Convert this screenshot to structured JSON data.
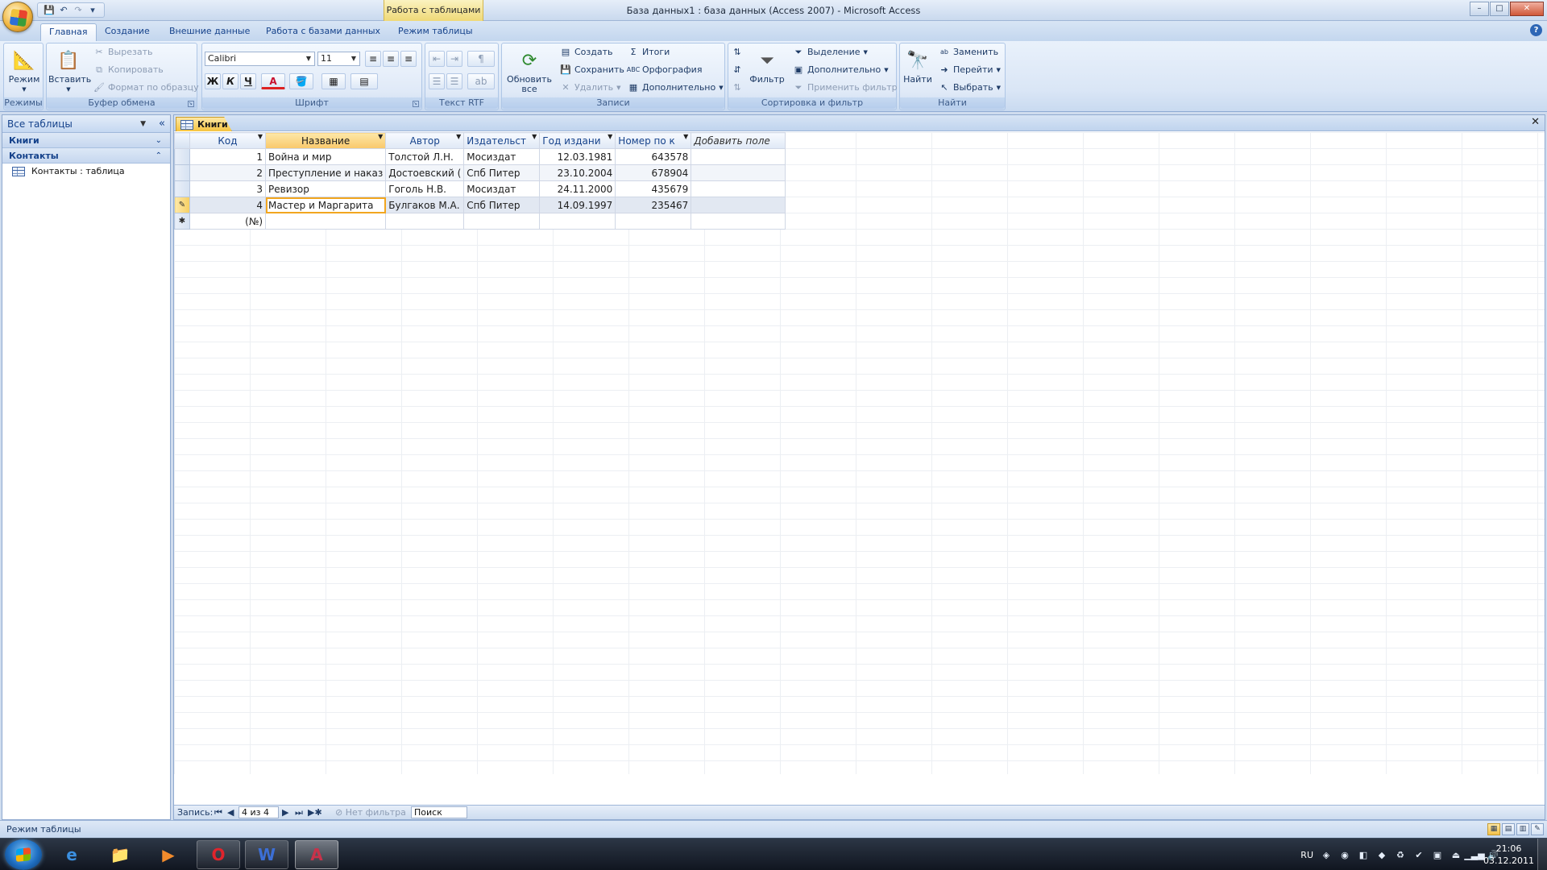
{
  "window": {
    "title": "База данных1 : база данных (Access 2007) - Microsoft Access",
    "context_tab": "Работа с таблицами",
    "controls": {
      "minimize": "–",
      "maximize": "□",
      "close": "✕"
    }
  },
  "quick_access": {
    "save": "💾",
    "undo": "↶",
    "redo": "↷",
    "customize": "▾"
  },
  "ribbon_tabs": [
    "Главная",
    "Создание",
    "Внешние данные",
    "Работа с базами данных",
    "Режим таблицы"
  ],
  "ribbon": {
    "views": {
      "group": "Режимы",
      "view_button": "Режим"
    },
    "clipboard": {
      "group": "Буфер обмена",
      "paste": "Вставить",
      "cut": "Вырезать",
      "copy": "Копировать",
      "format_painter": "Формат по образцу"
    },
    "font": {
      "group": "Шрифт",
      "font_name": "Calibri",
      "font_size": "11",
      "bold": "Ж",
      "italic": "К",
      "underline": "Ч",
      "font_color": "A"
    },
    "rich_text": {
      "group": "Текст RTF"
    },
    "records": {
      "group": "Записи",
      "refresh": "Обновить все",
      "new": "Создать",
      "save": "Сохранить",
      "delete": "Удалить",
      "totals": "Итоги",
      "spelling": "Орфография",
      "more": "Дополнительно"
    },
    "sort_filter": {
      "group": "Сортировка и фильтр",
      "filter": "Фильтр",
      "selection": "Выделение",
      "advanced": "Дополнительно",
      "toggle_filter": "Применить фильтр"
    },
    "find": {
      "group": "Найти",
      "find": "Найти",
      "replace": "Заменить",
      "goto": "Перейти",
      "select": "Выбрать"
    }
  },
  "nav_pane": {
    "header": "Все таблицы",
    "groups": [
      {
        "name": "Книги",
        "items": []
      },
      {
        "name": "Контакты",
        "items": [
          "Контакты : таблица"
        ]
      }
    ]
  },
  "document": {
    "tab": "Книги",
    "columns": [
      "Код",
      "Название",
      "Автор",
      "Издательст",
      "Год издани",
      "Номер по к",
      "Добавить поле"
    ],
    "rows": [
      [
        "1",
        "Война и мир",
        "Толстой Л.Н.",
        "Мосиздат",
        "12.03.1981",
        "643578"
      ],
      [
        "2",
        "Преступление и наказ",
        "Достоевский (",
        "Спб Питер",
        "23.10.2004",
        "678904"
      ],
      [
        "3",
        "Ревизор",
        "Гоголь Н.В.",
        "Мосиздат",
        "24.11.2000",
        "435679"
      ],
      [
        "4",
        "Мастер и Маргарита",
        "Булгаков М.А.",
        "Спб Питер",
        "14.09.1997",
        "235467"
      ]
    ],
    "new_row_placeholder": "(№)"
  },
  "record_nav": {
    "label": "Запись:",
    "position": "4 из 4",
    "filter": "Нет фильтра",
    "search": "Поиск"
  },
  "status_bar": {
    "text": "Режим таблицы"
  },
  "taskbar": {
    "language": "RU",
    "time": "21:06",
    "date": "03.12.2011"
  }
}
